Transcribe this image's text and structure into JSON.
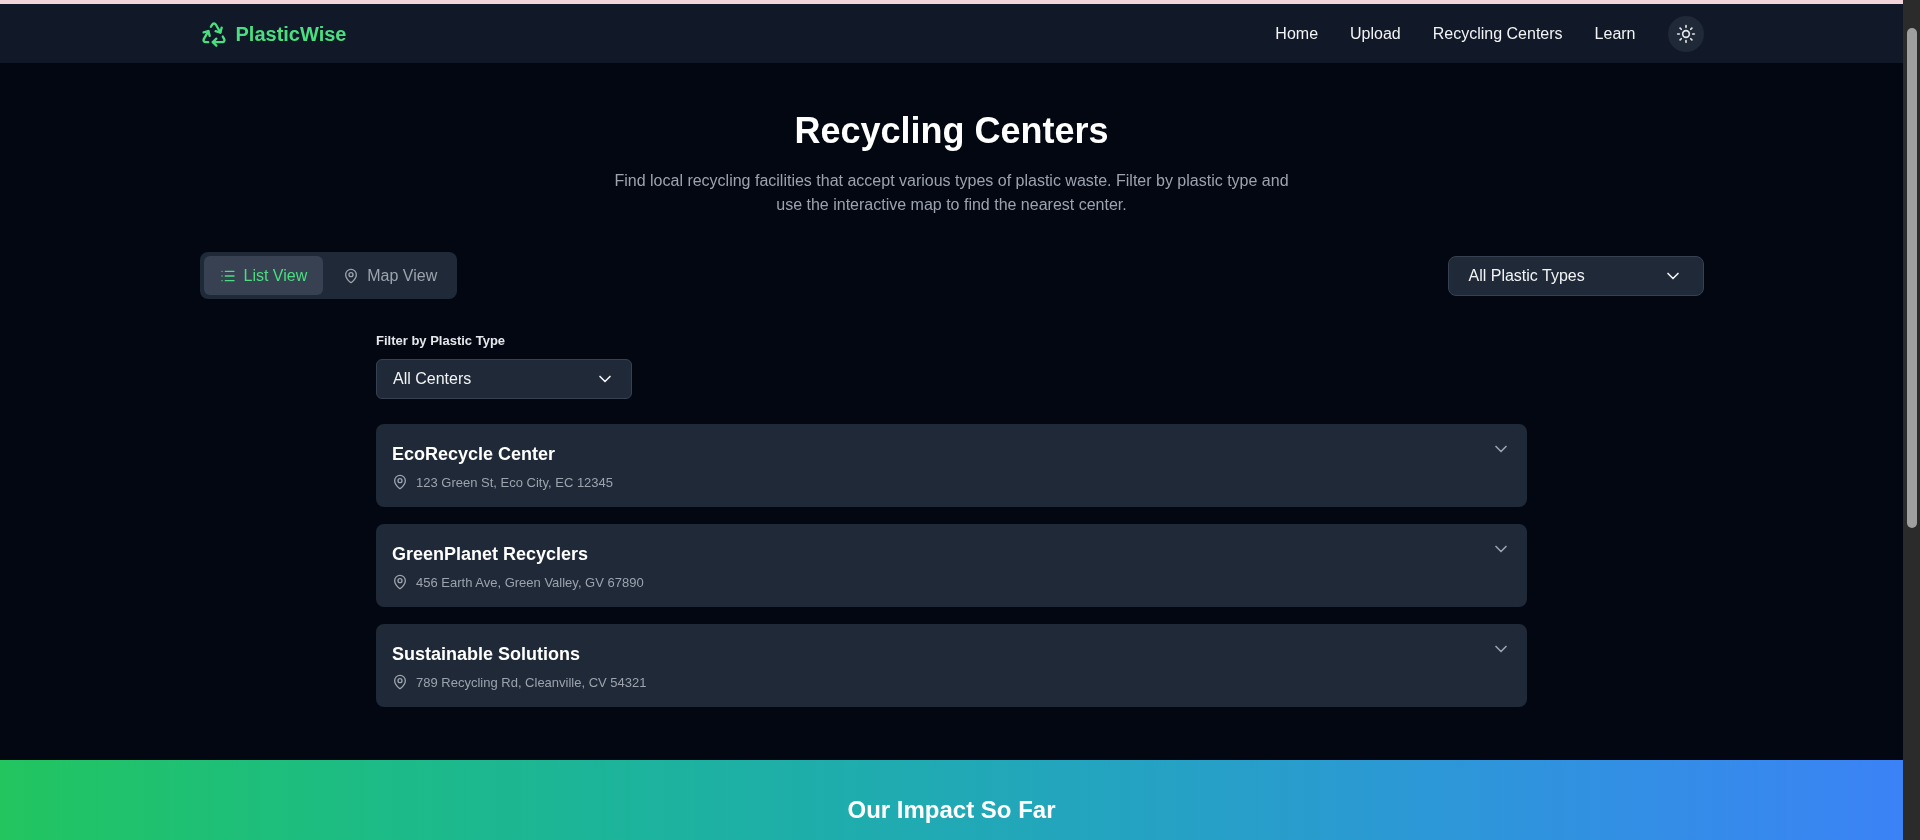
{
  "brand": {
    "name": "PlasticWise"
  },
  "nav": [
    {
      "label": "Home"
    },
    {
      "label": "Upload"
    },
    {
      "label": "Recycling Centers"
    },
    {
      "label": "Learn"
    }
  ],
  "page": {
    "title": "Recycling Centers",
    "subtitle": "Find local recycling facilities that accept various types of plastic waste. Filter by plastic type and use the interactive map to find the nearest center."
  },
  "view_tabs": [
    {
      "label": "List View",
      "selected": true
    },
    {
      "label": "Map View",
      "selected": false
    }
  ],
  "type_dropdown": {
    "value": "All Plastic Types"
  },
  "filter": {
    "label": "Filter by Plastic Type",
    "value": "All Centers"
  },
  "centers": [
    {
      "name": "EcoRecycle Center",
      "address": "123 Green St, Eco City, EC 12345",
      "expanded": false
    },
    {
      "name": "GreenPlanet Recyclers",
      "address": "456 Earth Ave, Green Valley, GV 67890",
      "expanded": false
    },
    {
      "name": "Sustainable Solutions",
      "address": "789 Recycling Rd, Cleanville, CV 54321",
      "expanded": false
    }
  ],
  "impact": {
    "title": "Our Impact So Far"
  }
}
